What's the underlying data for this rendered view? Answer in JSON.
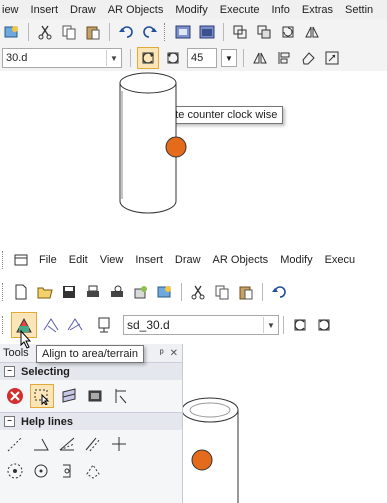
{
  "top": {
    "menu": [
      "iew",
      "Insert",
      "Draw",
      "AR Objects",
      "Modify",
      "Execute",
      "Info",
      "Extras",
      "Settin"
    ],
    "file_combo": "30.d",
    "angle_value": "45",
    "tooltip": "Rotate counter clock wise"
  },
  "bottom": {
    "menu": [
      "File",
      "Edit",
      "View",
      "Insert",
      "Draw",
      "AR Objects",
      "Modify",
      "Execu"
    ],
    "file_combo": "sd_30.d",
    "tooltip": "Align to area/terrain",
    "tools_title": "Tools",
    "tools_pin": "ᵖ",
    "tools_close": "✕",
    "sections": [
      {
        "label": "Selecting"
      },
      {
        "label": "Help lines"
      }
    ]
  },
  "colors": {
    "accent": "#e46a1c",
    "toolbar": "#f3f3f3",
    "panel": "#f5f6f7"
  }
}
